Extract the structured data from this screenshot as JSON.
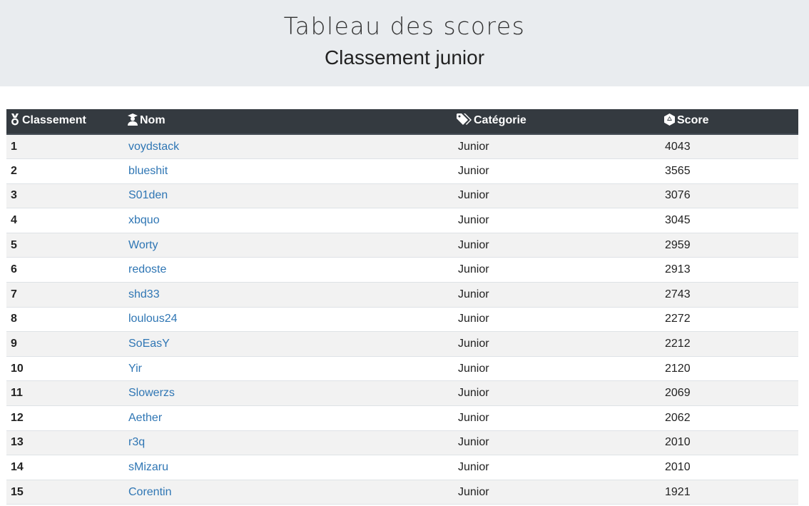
{
  "header": {
    "title": "Tableau des scores",
    "subtitle": "Classement junior"
  },
  "table": {
    "columns": [
      {
        "label": "Classement",
        "icon": "medal-icon"
      },
      {
        "label": "Nom",
        "icon": "graduate-icon"
      },
      {
        "label": "Catégorie",
        "icon": "tags-icon"
      },
      {
        "label": "Score",
        "icon": "dice-d20-icon"
      }
    ],
    "rows": [
      {
        "rank": "1",
        "name": "voydstack",
        "category": "Junior",
        "score": "4043"
      },
      {
        "rank": "2",
        "name": "blueshit",
        "category": "Junior",
        "score": "3565"
      },
      {
        "rank": "3",
        "name": "S01den",
        "category": "Junior",
        "score": "3076"
      },
      {
        "rank": "4",
        "name": "xbquo",
        "category": "Junior",
        "score": "3045"
      },
      {
        "rank": "5",
        "name": "Worty",
        "category": "Junior",
        "score": "2959"
      },
      {
        "rank": "6",
        "name": "redoste",
        "category": "Junior",
        "score": "2913"
      },
      {
        "rank": "7",
        "name": "shd33",
        "category": "Junior",
        "score": "2743"
      },
      {
        "rank": "8",
        "name": "loulous24",
        "category": "Junior",
        "score": "2272"
      },
      {
        "rank": "9",
        "name": "SoEasY",
        "category": "Junior",
        "score": "2212"
      },
      {
        "rank": "10",
        "name": "Yir",
        "category": "Junior",
        "score": "2120"
      },
      {
        "rank": "11",
        "name": "Slowerzs",
        "category": "Junior",
        "score": "2069"
      },
      {
        "rank": "12",
        "name": "Aether",
        "category": "Junior",
        "score": "2062"
      },
      {
        "rank": "13",
        "name": "r3q",
        "category": "Junior",
        "score": "2010"
      },
      {
        "rank": "14",
        "name": "sMizaru",
        "category": "Junior",
        "score": "2010"
      },
      {
        "rank": "15",
        "name": "Corentin",
        "category": "Junior",
        "score": "1921"
      }
    ]
  },
  "colors": {
    "header_bg": "#e9ecef",
    "table_head_bg": "#343a40",
    "link": "#2f76b4",
    "stripe": "#f2f2f2"
  }
}
